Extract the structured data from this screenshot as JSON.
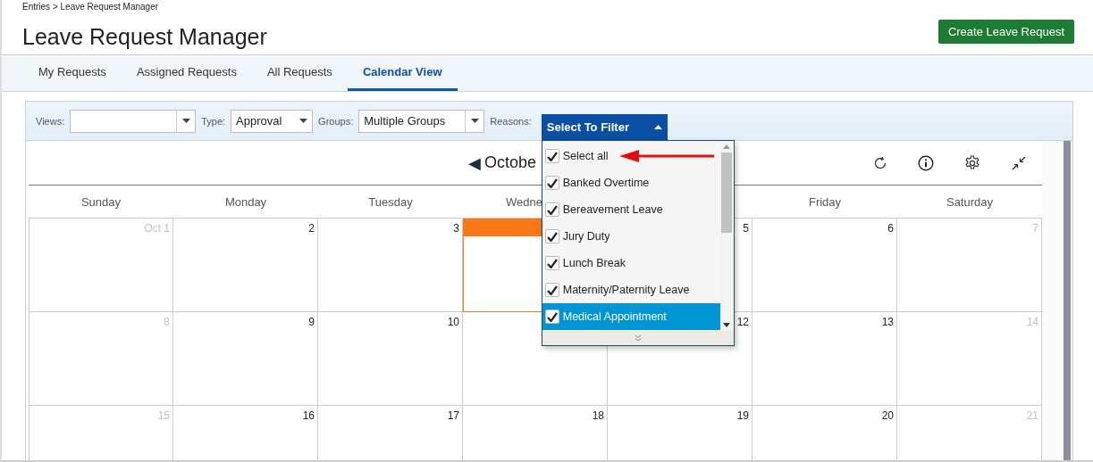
{
  "breadcrumb": "Entries > Leave Request Manager",
  "title": "Leave Request Manager",
  "create_button": "Create Leave Request",
  "tabs": [
    {
      "label": "My Requests",
      "selected": false
    },
    {
      "label": "Assigned Requests",
      "selected": false
    },
    {
      "label": "All Requests",
      "selected": false
    },
    {
      "label": "Calendar View",
      "selected": true
    }
  ],
  "filters": [
    {
      "label": "Views:"
    },
    {
      "label": "Type:",
      "value": "Approval"
    },
    {
      "label": "Groups:",
      "value": "Multiple Groups"
    }
  ],
  "reasons": {
    "label": "Reasons:",
    "button": "Select To Filter",
    "expanded": true,
    "options": [
      {
        "label": "Select all",
        "checked": true,
        "selected": false
      },
      {
        "label": "Banked Overtime",
        "checked": true,
        "selected": false
      },
      {
        "label": "Bereavement Leave",
        "checked": true,
        "selected": false
      },
      {
        "label": "Jury Duty",
        "checked": true,
        "selected": false
      },
      {
        "label": "Lunch Break",
        "checked": true,
        "selected": false
      },
      {
        "label": "Maternity/Paternity Leave",
        "checked": true,
        "selected": false
      },
      {
        "label": "Medical Appointment",
        "checked": true,
        "selected": true
      }
    ]
  },
  "calendar": {
    "prev": "◀",
    "month": "Octobe",
    "weekdays": [
      {
        "label": "Sunday"
      },
      {
        "label": "Monday"
      },
      {
        "label": "Tuesday"
      },
      {
        "label": "Wedne"
      },
      {
        "label": "Friday"
      },
      {
        "label": "Saturday"
      }
    ],
    "weeks": [
      [
        {
          "label": "Oct 1",
          "muted": true,
          "today": false
        },
        {
          "label": "2",
          "muted": false,
          "today": false
        },
        {
          "label": "3",
          "muted": false,
          "today": false
        },
        {
          "today": true
        },
        {
          "label": "5",
          "muted": false,
          "today": false
        },
        {
          "label": "6",
          "muted": false,
          "today": false
        },
        {
          "label": "7",
          "muted": true,
          "today": false
        }
      ],
      [
        {
          "label": "8",
          "muted": true,
          "today": false
        },
        {
          "label": "9",
          "muted": false,
          "today": false
        },
        {
          "label": "10",
          "muted": false,
          "today": false
        },
        {
          "today": false
        },
        {
          "label": "12",
          "muted": false,
          "today": false
        },
        {
          "label": "13",
          "muted": false,
          "today": false
        },
        {
          "label": "14",
          "muted": true,
          "today": false
        }
      ],
      [
        {
          "label": "15",
          "muted": true,
          "today": false
        },
        {
          "label": "16",
          "muted": false,
          "today": false
        },
        {
          "label": "17",
          "muted": false,
          "today": false
        },
        {
          "label": "18",
          "muted": false,
          "today": false
        },
        {
          "label": "19",
          "muted": false,
          "today": false
        },
        {
          "label": "20",
          "muted": false,
          "today": false
        },
        {
          "label": "21",
          "muted": true,
          "today": false
        }
      ]
    ]
  }
}
